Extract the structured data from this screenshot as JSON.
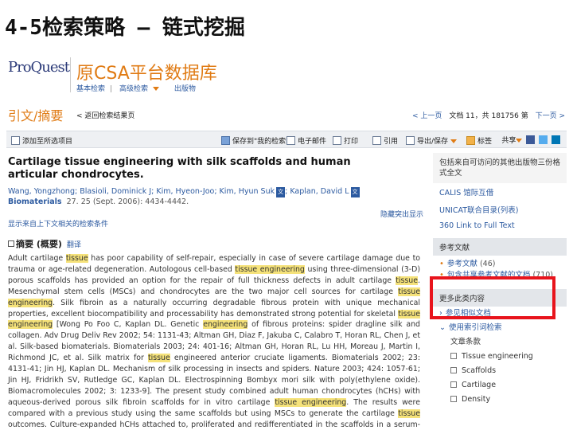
{
  "slide": {
    "title": "4-5检索策略 – 链式挖掘"
  },
  "header": {
    "logo_text": "ProQuest",
    "db_title": "原CSA平台数据库",
    "links": [
      "基本检索",
      "高级检索",
      "出版物"
    ]
  },
  "nav": {
    "page_heading": "引文/摘要",
    "back_link": "< 返回检索结果页",
    "pager": {
      "prev": "< 上一页",
      "doc_label": "文档 11，共 181756 第",
      "next": "下一页 >"
    }
  },
  "toolbar": {
    "items": [
      "添加至所选项目",
      "保存到\"我的检索\"",
      "电子邮件",
      "打印",
      "引用",
      "导出/保存",
      "标签"
    ],
    "share": "共享"
  },
  "article": {
    "title": "Cartilage tissue engineering with silk scaffolds and human articular chondrocytes.",
    "authors": "Wang, Yongzhong; Blasioli, Dominick J; Kim, Hyeon-Joo; Kim, Hyun Suk",
    "authors_tail": "; Kaplan, David L",
    "author_badge": "文",
    "journal": "Biomaterials",
    "journal_vol": "27. 25 (Sept. 2006): 4434-4442.",
    "show_terms": "显示来自上下文相关的检索条件",
    "hide_terms": "隐藏突出显示"
  },
  "abstract": {
    "heading": "摘要 (概要)",
    "translate": "翻译",
    "segments": [
      {
        "t": "Adult cartilage ",
        "h": false
      },
      {
        "t": "tissue",
        "h": true
      },
      {
        "t": " has poor capability of self-repair, especially in case of severe cartilage damage due to trauma or age-related degeneration. Autologous cell-based ",
        "h": false
      },
      {
        "t": "tissue engineering",
        "h": true
      },
      {
        "t": " using three-dimensional (3-D) porous scaffolds has provided an option for the repair of full thickness defects in adult cartilage ",
        "h": false
      },
      {
        "t": "tissue",
        "h": true
      },
      {
        "t": ". Mesenchymal stem cells (MSCs) and chondrocytes are the two major cell sources for cartilage ",
        "h": false
      },
      {
        "t": "tissue engineering",
        "h": true
      },
      {
        "t": ". Silk fibroin as a naturally occurring degradable fibrous protein with unique mechanical properties, excellent biocompatibility and processability has demonstrated strong potential for skeletal ",
        "h": false
      },
      {
        "t": "tissue engineering",
        "h": true
      },
      {
        "t": " [Wong Po Foo C, Kaplan DL. Genetic ",
        "h": false
      },
      {
        "t": "engineering",
        "h": true
      },
      {
        "t": " of fibrous proteins: spider dragline silk and collagen. Adv Drug Deliv Rev 2002; 54: 1131-43; Altman GH, Diaz F, Jakuba C, Calabro T, Horan RL, Chen J, et al. Silk-based biomaterials. Biomaterials 2003; 24: 401-16; Altman GH, Horan RL, Lu HH, Moreau J, Martin I, Richmond JC, et al. Silk matrix for ",
        "h": false
      },
      {
        "t": "tissue",
        "h": true
      },
      {
        "t": " engineered anterior cruciate ligaments. Biomaterials 2002; 23: 4131-41; Jin HJ, Kaplan DL. Mechanism of silk processing in insects and spiders. Nature 2003; 424: 1057-61; Jin HJ, Fridrikh SV, Rutledge GC, Kaplan DL. Electrospinning Bombyx mori silk with poly(ethylene oxide). Biomacromolecules 2002; 3: 1233-9]. The present study combined adult human chondrocytes (hCHs) with aqueous-derived porous silk fibroin scaffolds for in vitro cartilage ",
        "h": false
      },
      {
        "t": "tissue engineering",
        "h": true
      },
      {
        "t": ". The results were compared with a previous study using the same scaffolds but using MSCs to generate the cartilage ",
        "h": false
      },
      {
        "t": "tissue",
        "h": true
      },
      {
        "t": " outcomes. Culture-expanded hCHs attached to, proliferated and redifferentiated in the scaffolds in a serum-free, chemically defined medium",
        "h": false
      }
    ]
  },
  "right_panel": {
    "access_text": "包括来自可访问的其他出版物三份格式全文",
    "links": [
      "CALIS 馆际互借",
      "UNICAT联合目录(列表)",
      "360 Link to Full Text"
    ],
    "refs_heading": "参考文献",
    "refs": [
      {
        "label": "参考文献",
        "count": "(46)"
      },
      {
        "label": "包含共享参考文献的文档",
        "count": "(710)"
      }
    ],
    "more_heading": "更多此类内容",
    "more_links": [
      "参见相似文档",
      "使用索引词检索"
    ],
    "facet_heading": "文章条款",
    "facets": [
      "Tissue engineering",
      "Scaffolds",
      "Cartilage",
      "Density"
    ]
  }
}
